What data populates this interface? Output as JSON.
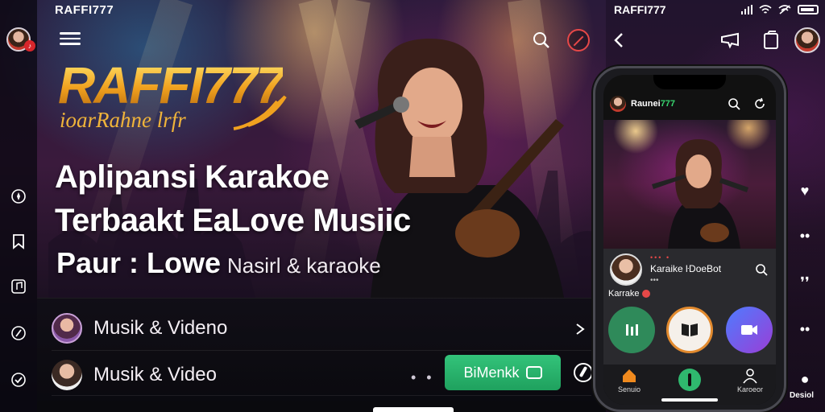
{
  "app": {
    "title": "RAFFI777",
    "status_title": "RAFFI777"
  },
  "hero": {
    "brand": "RAFFI777",
    "brand_sub": "ioarRahne lrfr",
    "headline_1": "Aplipansi Karakoe",
    "headline_2": "Terbaakt EaLove Musiic",
    "headline_3a": "Paur : Lowe",
    "headline_3b": "Nasirl & karaoke"
  },
  "list": {
    "rows": [
      {
        "label": "Musik & Videno"
      },
      {
        "label": "Musik & Video",
        "button": "BiMenkk"
      }
    ],
    "dots": "• •"
  },
  "phone": {
    "brand_prefix": "Raunei",
    "brand_suffix": "777",
    "card_title": "Karaike ŀDoeBot",
    "card_sub": "•••",
    "card_dots": "••• •",
    "tag": "Karrake",
    "tabs": [
      {
        "label": "Senuio",
        "icon": "home-icon"
      },
      {
        "label": "",
        "icon": "mic-icon"
      },
      {
        "label": "Karoeor",
        "icon": "profile-icon"
      }
    ]
  },
  "side": {
    "bottom_label": "Desiol"
  },
  "colors": {
    "accent_green": "#2fb86e",
    "brand_gold": "#f0a11f",
    "alert_red": "#e64848"
  }
}
